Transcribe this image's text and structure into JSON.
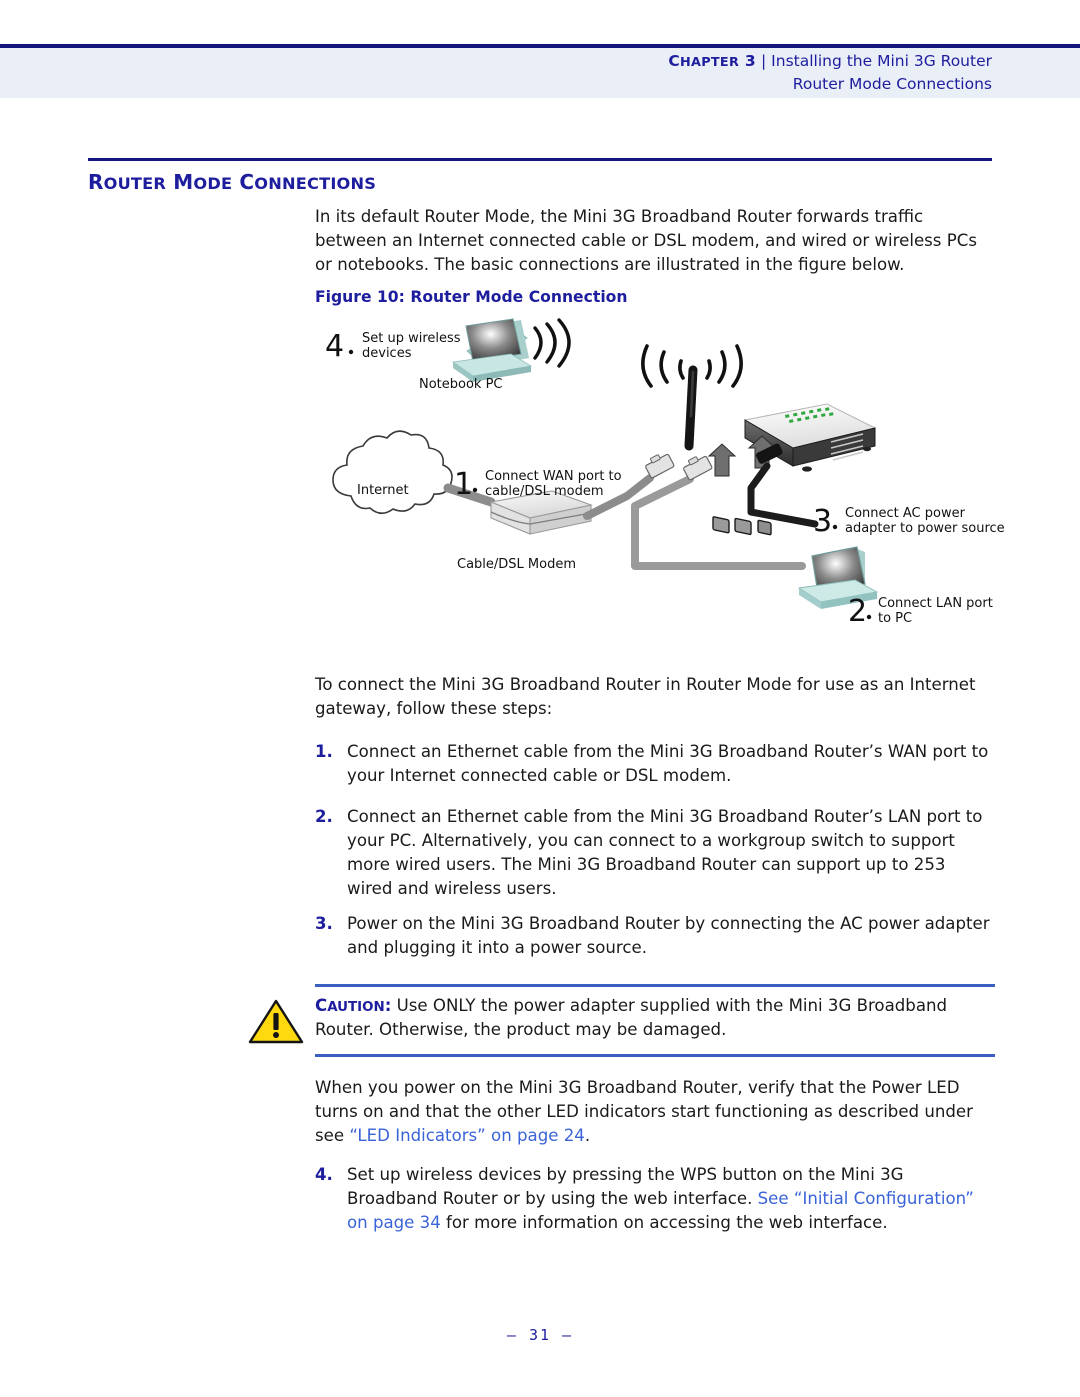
{
  "header": {
    "chapter_label": "CHAPTER",
    "chapter_number": "3",
    "separator": "|",
    "chapter_title": "Installing the Mini 3G Router",
    "section_title": "Router Mode Connections"
  },
  "section": {
    "heading": "ROUTER MODE CONNECTIONS",
    "intro": "In its default Router Mode, the Mini 3G Broadband Router forwards traffic between an Internet connected cable or DSL modem, and wired or wireless PCs or notebooks. The basic connections are illustrated in the figure below."
  },
  "figure": {
    "caption": "Figure 10:  Router Mode Connection",
    "callouts": [
      {
        "number": "1",
        "line1": "Connect WAN port to",
        "line2": "cable/DSL modem"
      },
      {
        "number": "2",
        "line1": "Connect LAN port",
        "line2": "to PC"
      },
      {
        "number": "3",
        "line1": "Connect AC power",
        "line2": "adapter to power source"
      },
      {
        "number": "4",
        "line1": "Set up wireless",
        "line2": "devices"
      }
    ],
    "device_labels": {
      "internet": "Internet",
      "modem": "Cable/DSL Modem",
      "notebook": "Notebook PC"
    },
    "colors": {
      "notebook_body": "#b9dfdc",
      "cable_gray": "#8c8c8c",
      "cable_black": "#1c1c1c",
      "router_body": "#f2f2f2"
    }
  },
  "body": {
    "lead_in": "To connect the Mini 3G Broadband Router in Router Mode for use as an Internet gateway, follow these steps:",
    "steps": [
      {
        "number": "1.",
        "text": "Connect an Ethernet cable from the Mini 3G Broadband Router’s WAN port to your Internet connected cable or DSL modem."
      },
      {
        "number": "2.",
        "text": "Connect an Ethernet cable from the Mini 3G Broadband Router’s LAN port to your PC. Alternatively, you can connect to a workgroup switch to support more wired users. The Mini 3G Broadband Router can support up to 253 wired and wireless users."
      },
      {
        "number": "3.",
        "text": "Power on the Mini 3G Broadband Router by connecting the AC power adapter and plugging it into a power source."
      }
    ],
    "caution": {
      "label": "CAUTION:",
      "text": " Use ONLY the power adapter supplied with the Mini 3G Broadband Router. Otherwise, the product may be damaged."
    },
    "post_caution": {
      "part1": "When you power on the Mini 3G Broadband Router, verify that the Power LED turns on and that the other LED indicators start functioning as described under see ",
      "link": "“LED Indicators” on page 24",
      "part2": "."
    },
    "step4": {
      "number": "4.",
      "part1": "Set up wireless devices by pressing the WPS button on the Mini 3G Broadband Router or by using the web interface. ",
      "link": "See “Initial Configuration” on page 34",
      "part2": " for more information on accessing the web interface."
    }
  },
  "footer": {
    "page_marker": "–  31  –"
  },
  "colors": {
    "navy": "#151580",
    "heading_blue": "#1d1d9e",
    "band": "#e9eef7",
    "link_blue": "#3a63d8",
    "caution_yellow": "#ffd910"
  }
}
